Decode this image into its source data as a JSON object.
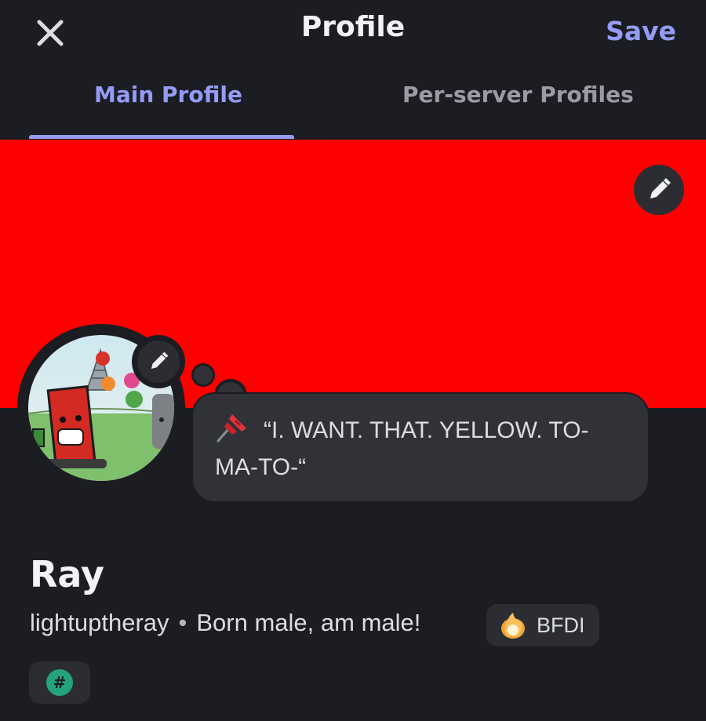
{
  "header": {
    "title": "Profile",
    "save_label": "Save",
    "close_icon": "close-icon"
  },
  "tabs": [
    {
      "label": "Main Profile",
      "active": true
    },
    {
      "label": "Per-server Profiles",
      "active": false
    }
  ],
  "banner": {
    "color": "#ff0000",
    "edit_icon": "pencil-icon"
  },
  "avatar": {
    "edit_icon": "pencil-icon"
  },
  "status": {
    "emoji": "pushpin-icon",
    "text": "“I. WANT. THAT. YELLOW. TO-MA-TO-“"
  },
  "profile": {
    "display_name": "Ray",
    "username": "lightuptheray",
    "separator": "•",
    "pronouns": "Born male, am male!",
    "tag": {
      "icon": "flame-badge-icon",
      "label": "BFDI"
    },
    "badge": {
      "icon": "hashtag-icon",
      "symbol": "#",
      "color": "#23a37d"
    }
  },
  "colors": {
    "background": "#1c1d22",
    "accent": "#949cf7",
    "surface": "#313238"
  }
}
